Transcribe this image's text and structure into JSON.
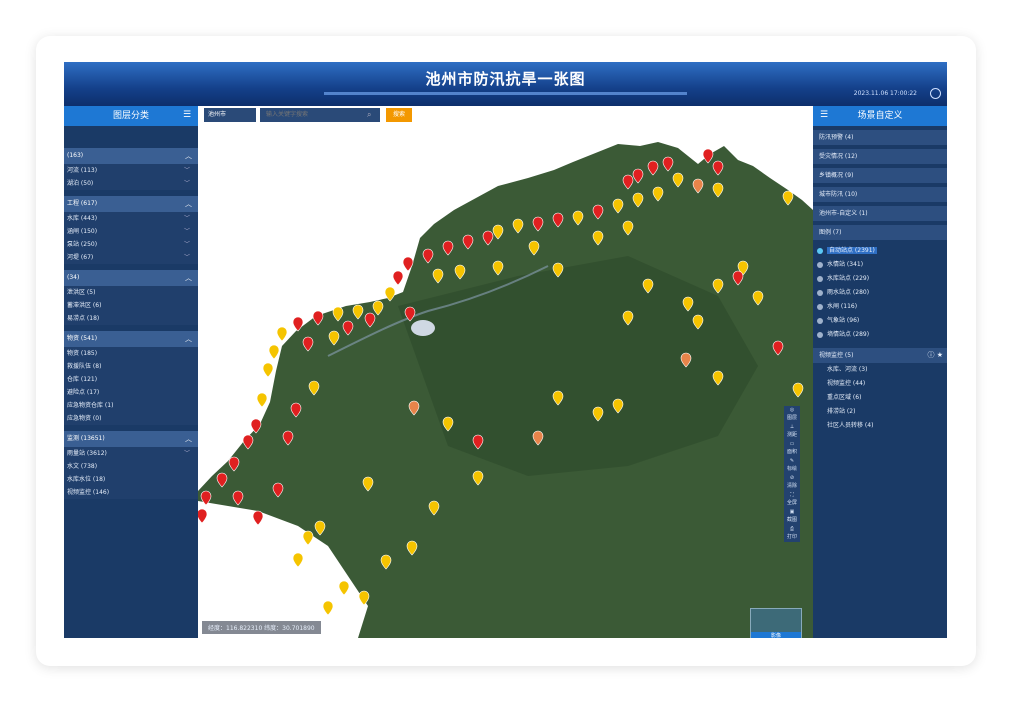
{
  "app": {
    "title": "池州市防汛抗旱一张图",
    "datetime": "2023.11.06 17:00:22"
  },
  "left_panel": {
    "title": "图层分类",
    "hint": "",
    "groups": [
      {
        "head": "(163)",
        "items": [
          "河流 (113)",
          "湖泊 (50)"
        ]
      },
      {
        "head": "工程 (617)",
        "items": [
          "水库 (443)",
          "涵闸 (150)",
          "泵站 (250)",
          "河堤 (67)"
        ]
      },
      {
        "head": "(34)",
        "items": [
          "泄洪区 (5)",
          "蓄滞洪区 (6)",
          "易涝点 (18)"
        ]
      },
      {
        "head": "物资 (541)",
        "items": [
          "物资 (185)",
          "救援队伍 (8)",
          "仓库 (121)",
          "避险点 (17)",
          "应急物资仓库 (1)",
          "应急物资 (0)"
        ]
      },
      {
        "head": "监测 (13651)",
        "items": [
          "雨量站 (3612)",
          "水文 (738)",
          "水库水位 (18)",
          "视频监控 (146)"
        ]
      }
    ]
  },
  "right_panel": {
    "title": "场景自定义",
    "items": [
      "防汛预警 (4)",
      "受灾情况 (12)",
      "乡镇概况 (9)",
      "城市防汛 (10)",
      "池州市-自定义 (1)"
    ],
    "legend_head": "图例 (7)",
    "legend": [
      "自动站点 (2391)",
      "水情站 (341)",
      "水库站点 (229)",
      "雨水站点 (280)",
      "水闸 (116)",
      "气象站 (96)",
      "墒情站点 (289)"
    ],
    "monitor_head": "视频监控 (5)",
    "monitor": [
      "水库、河流 (3)",
      "视频监控 (44)",
      "重点区域 (6)",
      "排涝站 (2)",
      "社区人员转移 (4)"
    ]
  },
  "search": {
    "select": "池州市",
    "placeholder": "输入关键字搜索",
    "button": "搜索"
  },
  "coords": "经度：116.822310   纬度：30.701890",
  "toolbar": [
    "图层",
    "测距",
    "面积",
    "标绘",
    "清除",
    "全屏",
    "截图",
    "打印"
  ],
  "thumb_label": "影像",
  "colors": {
    "header": "#14408a",
    "panel": "#1a3a66",
    "accent": "#1e78d4",
    "button": "#f39800",
    "pin_red": "#e02020",
    "pin_yellow": "#f5c400",
    "pin_orange": "#e8844a"
  }
}
